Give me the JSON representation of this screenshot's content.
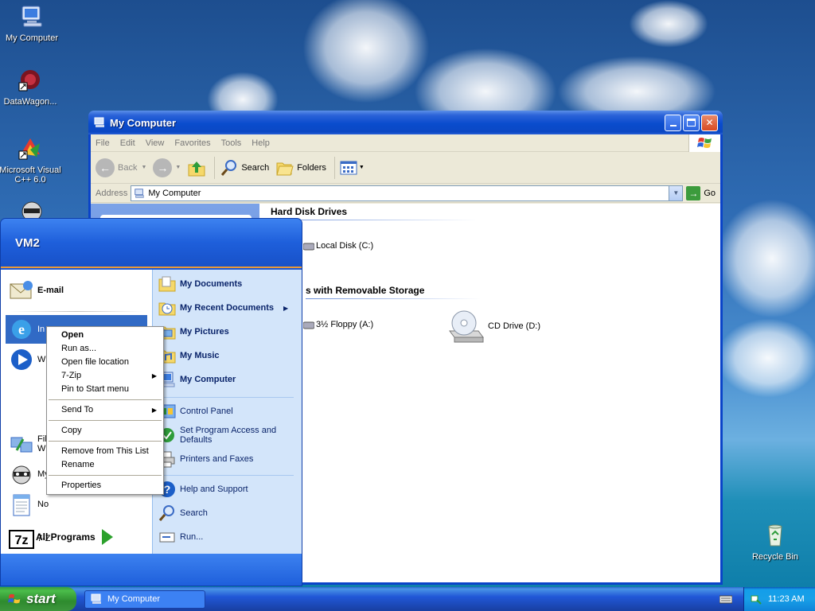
{
  "desktop": {
    "icons": [
      {
        "label": "My Computer"
      },
      {
        "label": "DataWagon..."
      },
      {
        "label": "Microsoft Visual C++ 6.0"
      },
      {
        "label": "Recycle Bin"
      }
    ]
  },
  "window": {
    "title": "My Computer",
    "menu": [
      "File",
      "Edit",
      "View",
      "Favorites",
      "Tools",
      "Help"
    ],
    "toolbar": {
      "back": "Back",
      "search": "Search",
      "folders": "Folders"
    },
    "address": {
      "label": "Address",
      "value": "My Computer",
      "go": "Go"
    },
    "groups": [
      {
        "header": "Hard Disk Drives",
        "items": [
          "Local Disk (C:)"
        ]
      },
      {
        "header": "Devices with Removable Storage",
        "visible_header": "s with Removable Storage",
        "items": [
          "3½ Floppy (A:)",
          "CD Drive (D:)"
        ]
      }
    ]
  },
  "start_menu": {
    "user": "VM2",
    "pinned": [
      {
        "label": "E-mail"
      },
      {
        "label": "In",
        "selected": true
      },
      {
        "label": "Wi"
      },
      {
        "label": "File",
        "label2": "Wi"
      },
      {
        "label": "My"
      },
      {
        "label": "No"
      },
      {
        "label": "7-Z"
      }
    ],
    "all_programs": "All Programs",
    "right": [
      {
        "label": "My Documents",
        "bold": true
      },
      {
        "label": "My Recent Documents",
        "bold": true,
        "submenu": true
      },
      {
        "label": "My Pictures",
        "bold": true
      },
      {
        "label": "My Music",
        "bold": true
      },
      {
        "label": "My Computer",
        "bold": true
      },
      {
        "label": "Control Panel"
      },
      {
        "label": "Set Program Access and Defaults"
      },
      {
        "label": "Printers and Faxes"
      },
      {
        "label": "Help and Support"
      },
      {
        "label": "Search"
      },
      {
        "label": "Run..."
      }
    ]
  },
  "context_menu": {
    "items": [
      "Open",
      "Run as...",
      "Open file location",
      "7-Zip",
      "Pin to Start menu",
      "Send To",
      "Copy",
      "Remove from This List",
      "Rename",
      "Properties"
    ]
  },
  "taskbar": {
    "start": "start",
    "task": "My Computer",
    "clock": "11:23 AM"
  }
}
